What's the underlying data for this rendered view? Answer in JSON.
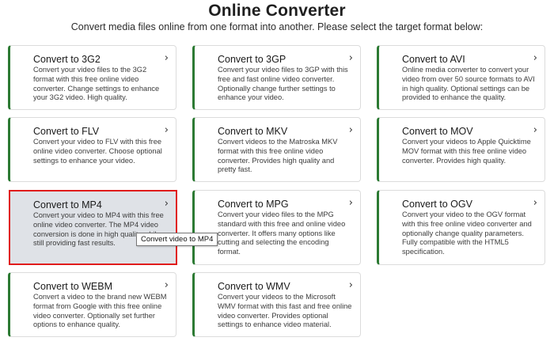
{
  "header": {
    "title": "Online Converter",
    "subtitle": "Convert media files online from one format into another. Please select the target format below:"
  },
  "cards": [
    {
      "title": "Convert to 3G2",
      "desc": "Convert your video files to the 3G2 format with this free online video converter. Change settings to enhance your 3G2 video. High quality."
    },
    {
      "title": "Convert to 3GP",
      "desc": "Convert your video files to 3GP with this free and fast online video converter. Optionally change further settings to enhance your video."
    },
    {
      "title": "Convert to AVI",
      "desc": "Online media converter to convert your video from over 50 source formats to AVI in high quality. Optional settings can be provided to enhance the quality."
    },
    {
      "title": "Convert to FLV",
      "desc": "Convert your video to FLV with this free online video converter. Choose optional settings to enhance your video."
    },
    {
      "title": "Convert to MKV",
      "desc": "Convert videos to the Matroska MKV format with this free online video converter. Provides high quality and pretty fast."
    },
    {
      "title": "Convert to MOV",
      "desc": "Convert your videos to Apple Quicktime MOV format with this free online video converter. Provides high quality."
    },
    {
      "title": "Convert to MP4",
      "desc": "Convert your video to MP4 with this free online video converter. The MP4 video conversion is done in high quality while still providing fast results."
    },
    {
      "title": "Convert to MPG",
      "desc": "Convert your video files to the MPG standard with this free and online video converter. It offers many options like cutting and selecting the encoding format."
    },
    {
      "title": "Convert to OGV",
      "desc": "Convert your video to the OGV format with this free online video converter and optionally change quality parameters. Fully compatible with the HTML5 specification."
    },
    {
      "title": "Convert to WEBM",
      "desc": "Convert a video to the brand new WEBM format from Google with this free online video converter. Optionally set further options to enhance quality."
    },
    {
      "title": "Convert to WMV",
      "desc": "Convert your videos to the Microsoft WMV format with this fast and free online video converter. Provides optional settings to enhance video material."
    }
  ],
  "tooltip": "Convert video to MP4",
  "icons": {
    "card_arrow": "chevron-right-icon",
    "card_arrow_glyph": "›"
  },
  "colors": {
    "accent_border": "#2c7a33",
    "selection_border": "#e01b1b",
    "selected_bg": "#dfe2e7"
  }
}
